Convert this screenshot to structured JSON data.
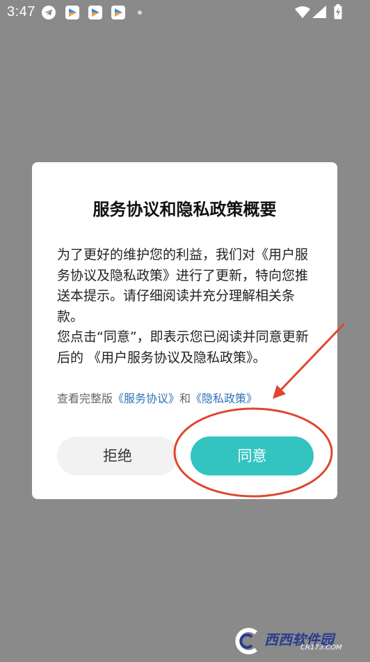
{
  "status_bar": {
    "time": "3:47"
  },
  "dialog": {
    "title": "服务协议和隐私政策概要",
    "paragraph1": "为了更好的维护您的利益，我们对《用户服务协议及隐私政策》进行了更新，特向您推送本提示。请仔细阅读并充分理解相关条款。",
    "paragraph2": "您点击“同意”，即表示您已阅读并同意更新后的 《用户服务协议及隐私政策》。",
    "links_prefix": "查看完整版",
    "service_link": "《服务协议》",
    "links_conjunction": "和",
    "privacy_link": "《隐私政策》",
    "reject_label": "拒绝",
    "agree_label": "同意"
  },
  "annotation": {
    "color": "#e0452e"
  },
  "watermark": {
    "brand": "西西软件园",
    "domain": "CR173.COM"
  },
  "colors": {
    "accent": "#33c4c1",
    "link": "#2b71b6",
    "overlay": "#8a8a8a"
  }
}
